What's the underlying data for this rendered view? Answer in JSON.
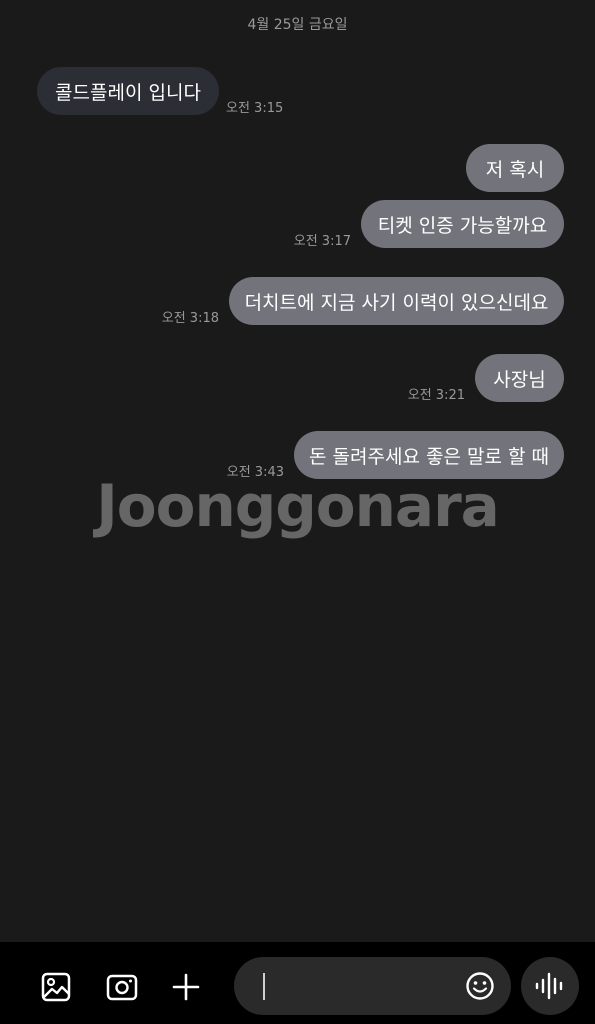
{
  "date_divider": "4월 25일 금요일",
  "messages": [
    {
      "direction": "incoming",
      "text": "콜드플레이 입니다",
      "time": "오전 3:15"
    },
    {
      "direction": "outgoing",
      "text": "저 혹시",
      "time": ""
    },
    {
      "direction": "outgoing",
      "text": "티켓 인증 가능할까요",
      "time": "오전 3:17"
    },
    {
      "direction": "outgoing",
      "text": "더치트에 지금 사기 이력이 있으신데요",
      "time": "오전 3:18"
    },
    {
      "direction": "outgoing",
      "text": "사장님",
      "time": "오전 3:21"
    },
    {
      "direction": "outgoing",
      "text": "돈 돌려주세요 좋은 말로 할 때",
      "time": "오전 3:43"
    }
  ],
  "watermark": "Joonggonara",
  "composer": {
    "gallery_icon": "image-icon",
    "camera_icon": "camera-icon",
    "plus_icon": "plus-icon",
    "emoji_icon": "smiley-icon",
    "voice_icon": "voice-wave-icon",
    "input_value": ""
  },
  "colors": {
    "background": "#1a1a1a",
    "incoming_bubble": "#2b2e35",
    "outgoing_bubble": "#73737b",
    "bottom_bar": "#000000"
  }
}
